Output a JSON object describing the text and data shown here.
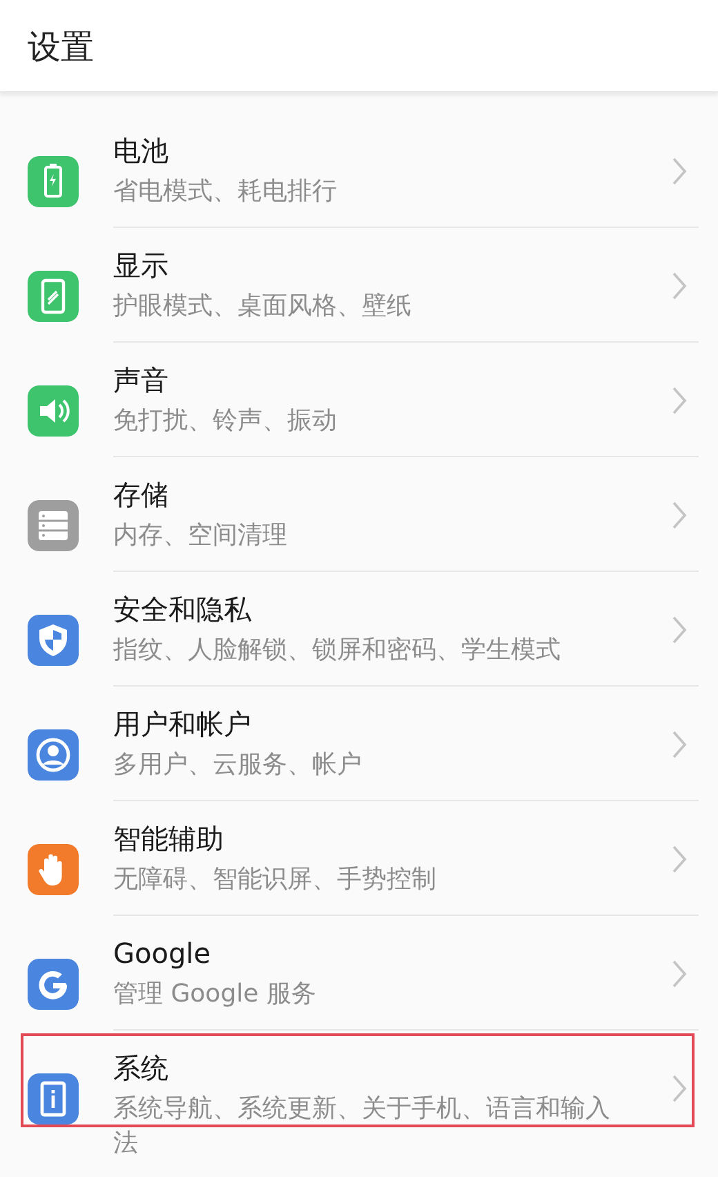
{
  "header": {
    "title": "设置"
  },
  "items": [
    {
      "kind": "battery",
      "color": "#3ec46d",
      "title": "电池",
      "subtitle": "省电模式、耗电排行",
      "highlighted": false
    },
    {
      "kind": "display",
      "color": "#3ec46d",
      "title": "显示",
      "subtitle": "护眼模式、桌面风格、壁纸",
      "highlighted": false
    },
    {
      "kind": "sound",
      "color": "#3ec46d",
      "title": "声音",
      "subtitle": "免打扰、铃声、振动",
      "highlighted": false
    },
    {
      "kind": "storage",
      "color": "#9e9e9e",
      "title": "存储",
      "subtitle": "内存、空间清理",
      "highlighted": false
    },
    {
      "kind": "security",
      "color": "#4a86df",
      "title": "安全和隐私",
      "subtitle": "指纹、人脸解锁、锁屏和密码、学生模式",
      "highlighted": false
    },
    {
      "kind": "users",
      "color": "#4a86df",
      "title": "用户和帐户",
      "subtitle": "多用户、云服务、帐户",
      "highlighted": false
    },
    {
      "kind": "accessibility",
      "color": "#f27b2b",
      "title": "智能辅助",
      "subtitle": "无障碍、智能识屏、手势控制",
      "highlighted": false
    },
    {
      "kind": "google",
      "color": "#4a86df",
      "title": "Google",
      "subtitle": "管理 Google 服务",
      "highlighted": false
    },
    {
      "kind": "system",
      "color": "#4a86df",
      "title": "系统",
      "subtitle": "系统导航、系统更新、关于手机、语言和输入法",
      "highlighted": true
    }
  ]
}
